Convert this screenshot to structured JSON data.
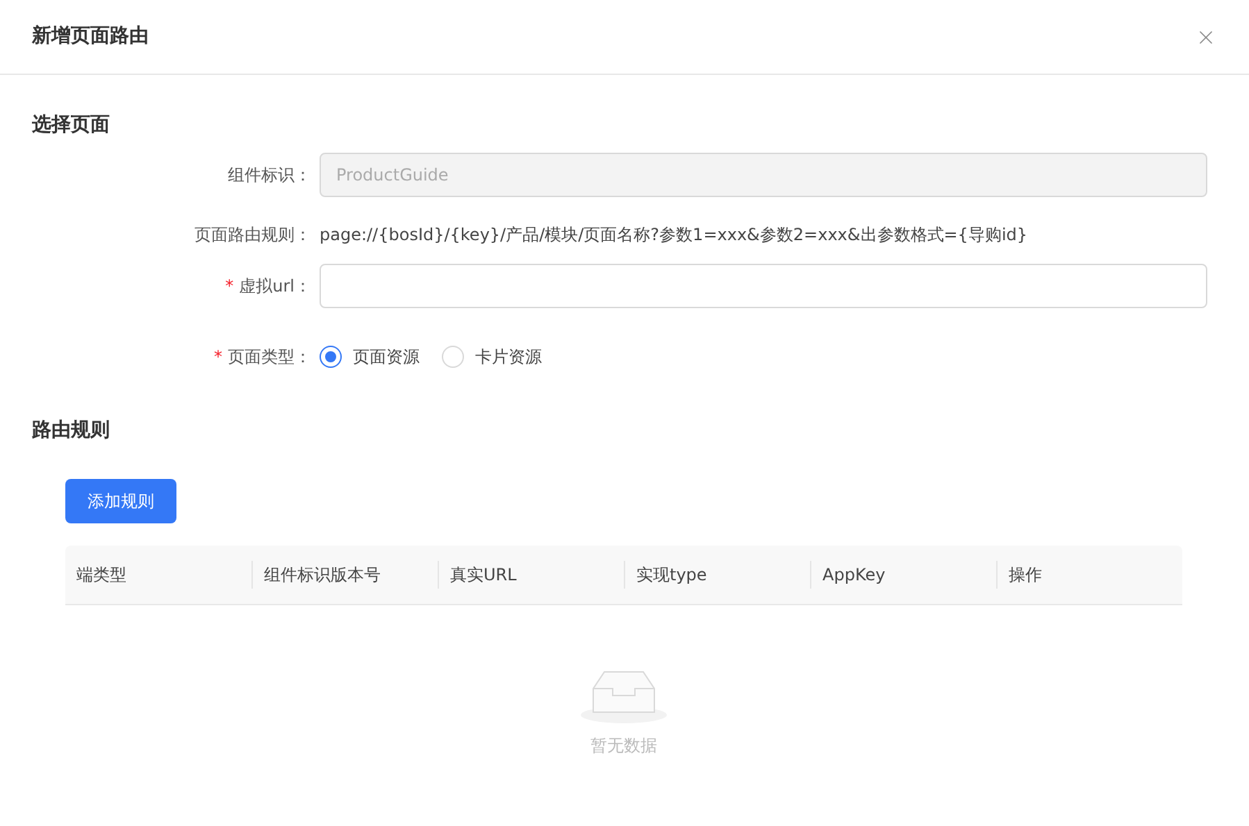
{
  "dialog": {
    "title": "新增页面路由"
  },
  "page_section": {
    "title": "选择页面",
    "component_id": {
      "label": "组件标识：",
      "value": "ProductGuide",
      "disabled": true
    },
    "route_rule": {
      "label": "页面路由规则：",
      "value": "page://{bosId}/{key}/产品/模块/页面名称?参数1=xxx&参数2=xxx&出参数格式={导购id}"
    },
    "virtual_url": {
      "label": "虚拟url：",
      "required_mark": "*"
    },
    "page_type": {
      "label": "页面类型：",
      "required_mark": "*",
      "options": [
        {
          "label": "页面资源",
          "selected": true
        },
        {
          "label": "卡片资源",
          "selected": false
        }
      ]
    }
  },
  "route_section": {
    "title": "路由规则",
    "add_button": "添加规则",
    "table": {
      "columns": [
        "端类型",
        "组件标识版本号",
        "真实URL",
        "实现type",
        "AppKey",
        "操作"
      ],
      "empty_text": "暂无数据"
    }
  }
}
